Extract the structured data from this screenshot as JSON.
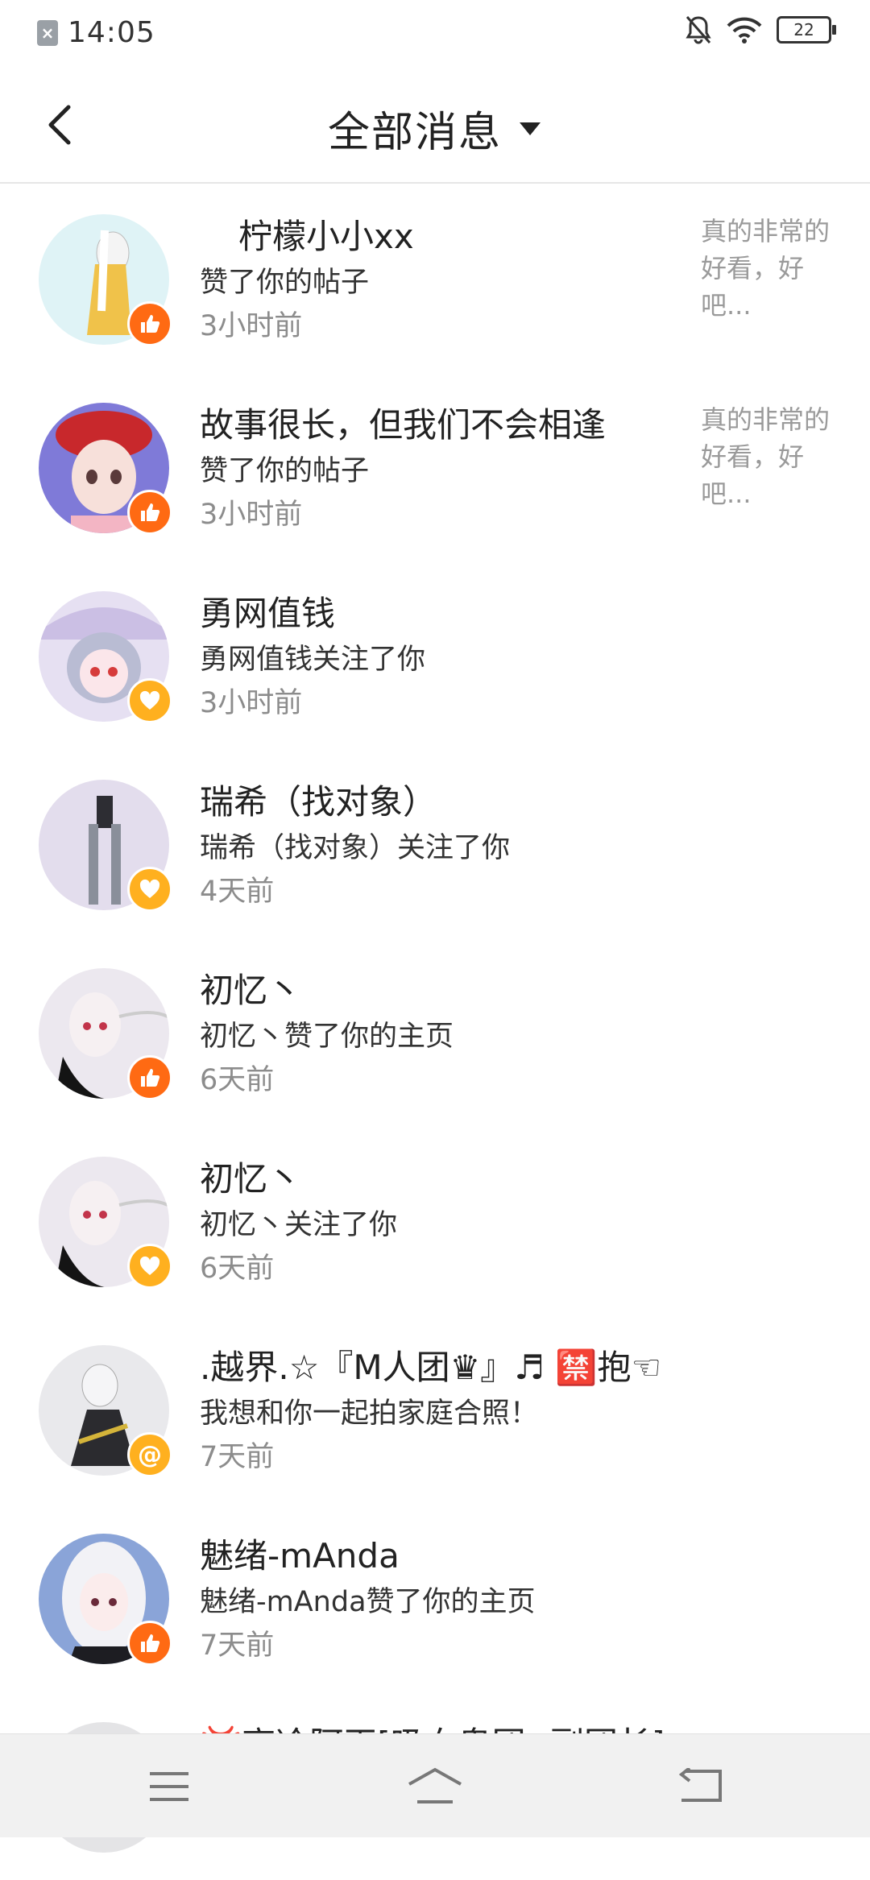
{
  "status_bar": {
    "time": "14:05",
    "battery": "22"
  },
  "header": {
    "title": "全部消息"
  },
  "messages": [
    {
      "name": "柠檬小小xx",
      "desc": "赞了你的帖子",
      "time": "3小时前",
      "badge": "like",
      "preview": "真的非常的好看，好吧..."
    },
    {
      "name": "故事很长，但我们不会相逢",
      "desc": "赞了你的帖子",
      "time": "3小时前",
      "badge": "like",
      "preview": "真的非常的好看，好吧..."
    },
    {
      "name": "勇网值钱",
      "desc": "勇网值钱关注了你",
      "time": "3小时前",
      "badge": "follow"
    },
    {
      "name": "瑞希（找对象）",
      "desc": "瑞希（找对象）关注了你",
      "time": "4天前",
      "badge": "follow"
    },
    {
      "name": "初忆丶",
      "desc": "初忆丶赞了你的主页",
      "time": "6天前",
      "badge": "like"
    },
    {
      "name": "初忆丶",
      "desc": "初忆丶关注了你",
      "time": "6天前",
      "badge": "follow"
    },
    {
      "name": ".越界.☆『M人团♛』♬ 🈲抱☜",
      "desc": "我想和你一起拍家庭合照！",
      "time": "7天前",
      "badge": "at",
      "badge_text": "@"
    },
    {
      "name": "魅绪-mAnda",
      "desc": "魅绪-mAnda赞了你的主页",
      "time": "7天前",
      "badge": "like"
    },
    {
      "name": "💢高冷阿巫[吸血鬼团--副团长]",
      "desc": "",
      "time": "",
      "badge": ""
    }
  ],
  "colors": {
    "like": "#ff6a13",
    "follow": "#ffb01f",
    "secondary_text": "#8c8c8c"
  },
  "icons": [
    "back-arrow-icon",
    "dropdown-triangle-icon",
    "like-icon",
    "heart-icon",
    "at-icon",
    "menu-icon",
    "home-icon",
    "return-icon",
    "bell-off-icon",
    "wifi-icon"
  ]
}
